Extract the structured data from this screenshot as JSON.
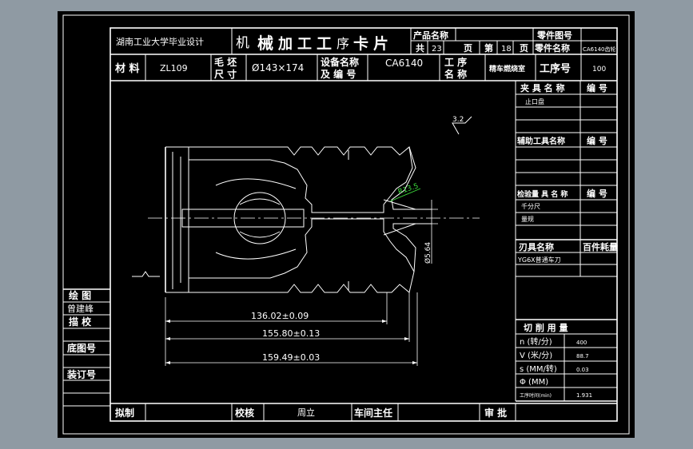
{
  "header": {
    "school": "湖南工业大学毕业设计",
    "title_chars": [
      "机",
      "械",
      "加",
      "工",
      "工",
      "序",
      "卡",
      "片"
    ],
    "product_name_label": "产品名称",
    "part_no_label": "零件图号",
    "total_label": "共",
    "total_pages": "23",
    "page_unit": "页",
    "nth_label": "第",
    "page_no": "18",
    "page_unit2": "页",
    "part_name_label": "零件名称",
    "part_name_value": "CA6140齿轮",
    "material_label": "材 料",
    "material_value": "ZL109",
    "blank_size_label_1": "毛 坯",
    "blank_size_label_2": "尺 寸",
    "blank_size_value": "Ø143×174",
    "equipment_label_1": "设备名称",
    "equipment_label_2": "及 编 号",
    "equipment_value": "CA6140",
    "process_name_label_1": "工  序",
    "process_name_label_2": "名  称",
    "process_name_value": "精车燃烧室",
    "process_no_label": "工序号",
    "process_no_value": "100"
  },
  "right_panel": {
    "fixture_label": "夹 具 名 称",
    "fixture_no_label": "编  号",
    "fixture_value": "止口盘",
    "aux_tool_label": "辅助工具名称",
    "aux_tool_no_label": "编  号",
    "gauge_label": "检验量 具 名 称",
    "gauge_no_label": "编  号",
    "gauge_values": [
      "千分尺",
      "量规"
    ],
    "cutter_label": "刃具名称",
    "cutter_consumption_label": "百件耗量",
    "cutter_value": "YG6X普通车刀",
    "cutting_label": "切    削    用    量",
    "params": [
      {
        "label": "n (转/分)",
        "value": "400"
      },
      {
        "label": "V (米/分)",
        "value": "88.7"
      },
      {
        "label": "s (MM/转)",
        "value": "0.03"
      },
      {
        "label": "Φ (MM)",
        "value": ""
      },
      {
        "label": "工序时间(min)",
        "value": "1.931"
      }
    ]
  },
  "left_panel": {
    "draw_label": "绘  图",
    "drawer_name": "曾建峰",
    "trace_label": "描  校",
    "base_no_label": "底图号",
    "binding_no_label": "装订号"
  },
  "footer": {
    "draft_label": "拟制",
    "check_label": "校核",
    "checker_name": "周立",
    "workshop_label": "车间主任",
    "approve_label": "审 批"
  },
  "drawing": {
    "roughness": "3.2",
    "radius_label": "R13.5",
    "dia_label": "Ø5.64",
    "dims": [
      "136.02±0.09",
      "155.80±0.13",
      "159.49±0.03"
    ]
  },
  "colors": {
    "background": "#8f9aa3",
    "sheet": "#000000",
    "line": "#ffffff",
    "annotation": "#3cdc3c"
  }
}
